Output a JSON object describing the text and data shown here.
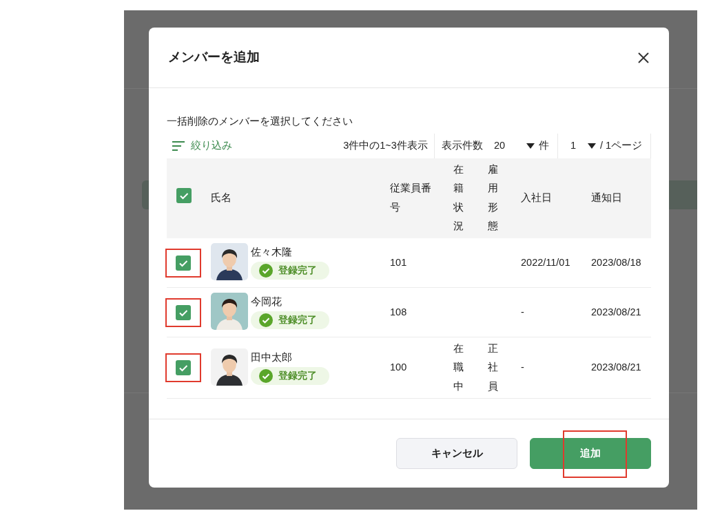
{
  "dialog": {
    "title": "メンバーを追加",
    "instruction": "一括削除のメンバーを選択してください",
    "filter": {
      "label": "絞り込み"
    },
    "result_count": "3件中の1~3件表示",
    "page_size": {
      "label": "表示件数",
      "value": "20",
      "unit": "件"
    },
    "page": {
      "value": "1",
      "suffix": "/ 1ページ"
    },
    "table": {
      "select_all": {
        "checked": true
      },
      "columns": [
        {
          "label": "氏名",
          "kind": "text"
        },
        {
          "label": "従業員番号",
          "kind": "text"
        },
        {
          "label": "在籍状況",
          "kind": "vertical"
        },
        {
          "label": "雇用形態",
          "kind": "vertical"
        },
        {
          "label": "入社日",
          "kind": "text"
        },
        {
          "label": "通知日",
          "kind": "text"
        }
      ],
      "rows": [
        {
          "checked": true,
          "highlighted": true,
          "name": "佐々木隆",
          "status": "登録完了",
          "employee_no": "101",
          "hire_date": "2022/11/01",
          "notice_date": "2023/08/18"
        },
        {
          "checked": true,
          "highlighted": true,
          "name": "今岡花",
          "status": "登録完了",
          "employee_no": "108",
          "hire_date": "-",
          "notice_date": "2023/08/21"
        },
        {
          "checked": true,
          "highlighted": true,
          "name": "田中太郎",
          "status": "登録完了",
          "employee_no": "100",
          "enrollment": "在職中",
          "employment_type": "正社員",
          "hire_date": "-",
          "notice_date": "2023/08/21"
        }
      ]
    },
    "buttons": [
      {
        "label": "キャンセル",
        "kind": "secondary",
        "highlighted": false
      },
      {
        "label": "追加",
        "kind": "primary",
        "highlighted": true
      }
    ]
  }
}
